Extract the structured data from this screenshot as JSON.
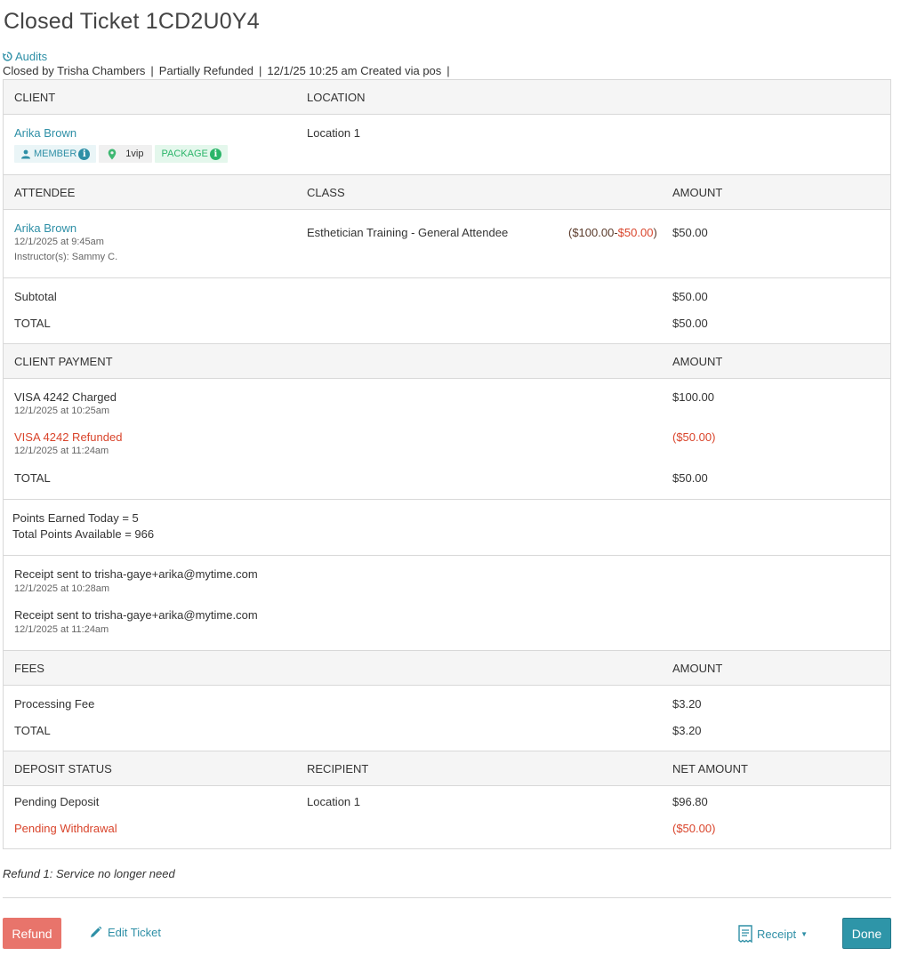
{
  "title": "Closed Ticket 1CD2U0Y4",
  "audits_label": "Audits",
  "meta": {
    "closed_by": "Closed by Trisha Chambers",
    "status": "Partially Refunded",
    "created": "12/1/25 10:25 am Created via pos"
  },
  "client_section": {
    "client_header": "CLIENT",
    "location_header": "LOCATION",
    "client_name": "Arika Brown",
    "location": "Location 1",
    "badges": {
      "member": "MEMBER",
      "vip": "1vip",
      "package": "PACKAGE"
    }
  },
  "attendee_section": {
    "attendee_header": "ATTENDEE",
    "class_header": "CLASS",
    "amount_header": "AMOUNT",
    "attendee_name": "Arika Brown",
    "attendee_time": "12/1/2025 at 9:45am",
    "instructor": "Instructor(s):  Sammy C.",
    "class_name": "Esthetician Training - General Attendee",
    "price_original": "($100.00",
    "price_dash": "-",
    "price_discount": "$50.00",
    "price_close": ")",
    "amount": "$50.00"
  },
  "totals": {
    "subtotal_label": "Subtotal",
    "subtotal": "$50.00",
    "total_label": "TOTAL",
    "total": "$50.00"
  },
  "payment_section": {
    "header": "CLIENT PAYMENT",
    "amount_header": "AMOUNT",
    "charged_label": "VISA 4242 Charged",
    "charged_time": "12/1/2025 at 10:25am",
    "charged_amount": "$100.00",
    "refunded_label": "VISA 4242 Refunded",
    "refunded_time": "12/1/2025 at 11:24am",
    "refunded_amount": "($50.00)",
    "total_label": "TOTAL",
    "total": "$50.00"
  },
  "points": {
    "earned": "Points Earned Today = 5",
    "available": "Total Points Available = 966"
  },
  "receipts": [
    {
      "label": "Receipt sent to  trisha-gaye+arika@mytime.com",
      "time": "12/1/2025 at 10:28am"
    },
    {
      "label": "Receipt sent to  trisha-gaye+arika@mytime.com",
      "time": "12/1/2025 at 11:24am"
    }
  ],
  "fees_section": {
    "header": "FEES",
    "amount_header": "AMOUNT",
    "fee_label": "Processing Fee",
    "fee_amount": "$3.20",
    "total_label": "TOTAL",
    "total": "$3.20"
  },
  "deposit_section": {
    "status_header": "DEPOSIT STATUS",
    "recipient_header": "RECIPIENT",
    "net_header": "NET AMOUNT",
    "pending_deposit": "Pending Deposit",
    "recipient": "Location 1",
    "deposit_amount": "$96.80",
    "pending_withdrawal": "Pending Withdrawal",
    "withdrawal_amount": "($50.00)"
  },
  "refund_note": "Refund 1: Service no longer need",
  "actions": {
    "refund": "Refund",
    "edit_ticket": "Edit Ticket",
    "receipt": "Receipt",
    "done": "Done"
  },
  "colors": {
    "link": "#2e8fa6",
    "refund_red": "#d9442b",
    "refund_button": "#e8746b",
    "done_button": "#2e95a8",
    "package_green": "#2bb569"
  }
}
